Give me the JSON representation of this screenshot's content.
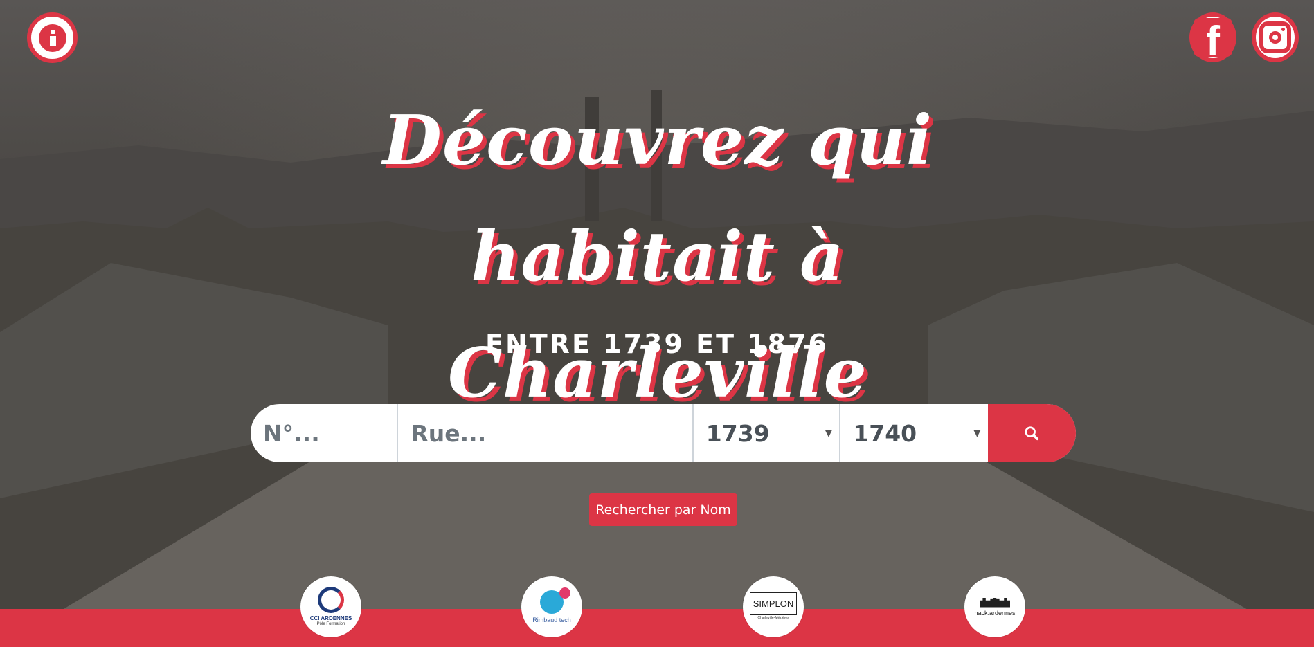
{
  "header": {
    "info_icon": "info-circle-icon",
    "social": [
      {
        "name": "facebook",
        "icon": "facebook-icon"
      },
      {
        "name": "instagram",
        "icon": "instagram-icon"
      }
    ]
  },
  "hero": {
    "title_line1": "Découvrez qui habitait à",
    "title_line2": "Charleville",
    "subtitle": "ENTRE 1739 ET 1876"
  },
  "search": {
    "number_placeholder": "N°...",
    "street_placeholder": "Rue...",
    "year_from": "1739",
    "year_to": "1740",
    "submit_icon": "search-icon"
  },
  "name_search_button": "Rechercher par Nom",
  "partners": [
    {
      "name": "CCI ARDENNES",
      "sub": "Pôle Formation"
    },
    {
      "name": "Rimbaud tech",
      "sub": ""
    },
    {
      "name": "SIMPLON",
      "sub": "Charleville-Mézières"
    },
    {
      "name": "hack:ardennes",
      "sub": ""
    }
  ],
  "colors": {
    "accent": "#dc3545",
    "background": "#555250",
    "text": "#ffffff"
  }
}
